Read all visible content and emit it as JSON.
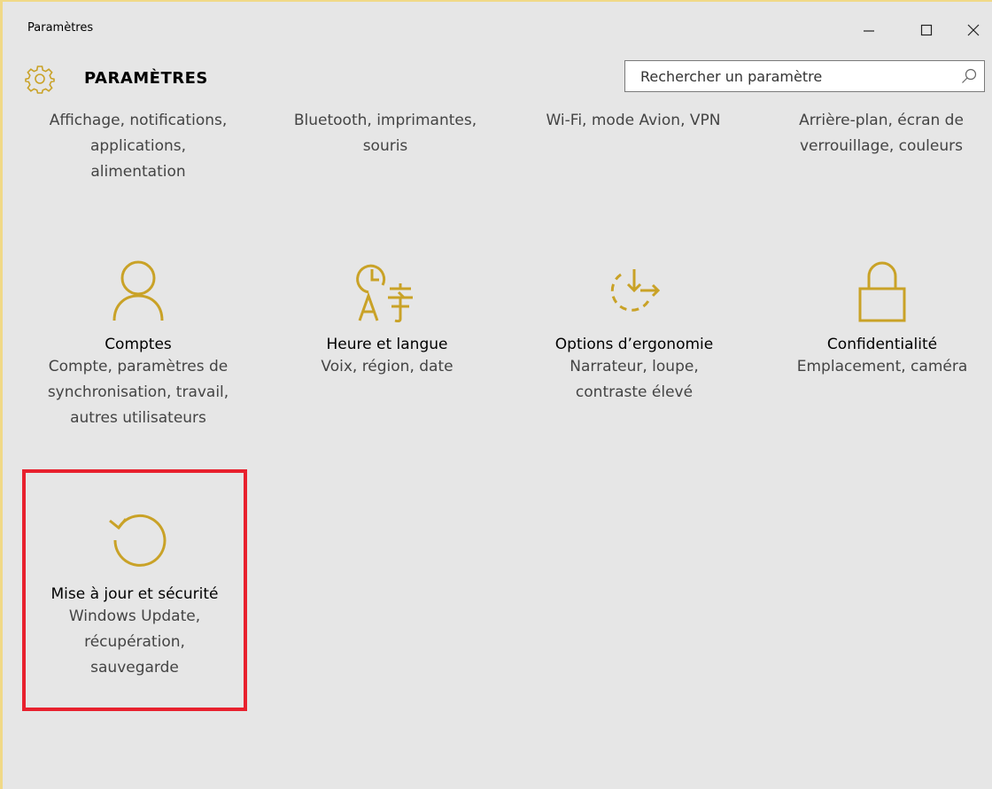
{
  "window": {
    "title": "Paramètres",
    "controls": {
      "minimize": "—",
      "maximize": "☐",
      "close": "✕"
    }
  },
  "header": {
    "title": "PARAMÈTRES",
    "search_placeholder": "Rechercher un paramètre"
  },
  "accent_color": "#c9a227",
  "highlight_color": "#e8212e",
  "tiles_top_row": [
    {
      "desc": "Affichage, notifications,\napplications,\nalimentation"
    },
    {
      "desc": "Bluetooth, imprimantes,\nsouris"
    },
    {
      "desc": "Wi-Fi, mode Avion, VPN"
    },
    {
      "desc": "Arrière-plan, écran de\nverrouillage, couleurs"
    }
  ],
  "tiles": [
    {
      "icon": "person-icon",
      "title": "Comptes",
      "desc": "Compte, paramètres de\nsynchronisation, travail,\nautres utilisateurs"
    },
    {
      "icon": "time-language-icon",
      "title": "Heure et langue",
      "desc": "Voix, région, date"
    },
    {
      "icon": "ease-of-access-icon",
      "title": "Options d’ergonomie",
      "desc": "Narrateur, loupe,\ncontraste élevé"
    },
    {
      "icon": "lock-icon",
      "title": "Confidentialité",
      "desc": "Emplacement, caméra"
    },
    {
      "icon": "update-icon",
      "title": "Mise à jour et sécurité",
      "desc": "Windows Update,\nrécupération,\nsauvegarde"
    }
  ]
}
